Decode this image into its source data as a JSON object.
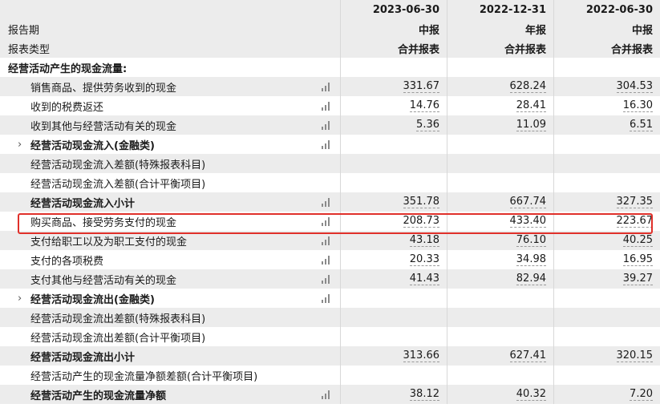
{
  "header": {
    "dates": [
      "2023-06-30",
      "2022-12-31",
      "2022-06-30"
    ],
    "report_period_label": "报告期",
    "report_periods": [
      "中报",
      "年报",
      "中报"
    ],
    "report_type_label": "报表类型",
    "report_types": [
      "合并报表",
      "合并报表",
      "合并报表"
    ]
  },
  "section_title": "经营活动产生的现金流量:",
  "rows": [
    {
      "label": "销售商品、提供劳务收到的现金",
      "values": [
        "331.67",
        "628.24",
        "304.53"
      ]
    },
    {
      "label": "收到的税费返还",
      "values": [
        "14.76",
        "28.41",
        "16.30"
      ]
    },
    {
      "label": "收到其他与经营活动有关的现金",
      "values": [
        "5.36",
        "11.09",
        "6.51"
      ]
    },
    {
      "label": "经营活动现金流入(金融类)",
      "values": [
        "",
        "",
        ""
      ]
    },
    {
      "label": "经营活动现金流入差额(特殊报表科目)",
      "values": [
        "",
        "",
        ""
      ]
    },
    {
      "label": "经营活动现金流入差额(合计平衡项目)",
      "values": [
        "",
        "",
        ""
      ]
    },
    {
      "label": "经营活动现金流入小计",
      "values": [
        "351.78",
        "667.74",
        "327.35"
      ]
    },
    {
      "label": "购买商品、接受劳务支付的现金",
      "values": [
        "208.73",
        "433.40",
        "223.67"
      ]
    },
    {
      "label": "支付给职工以及为职工支付的现金",
      "values": [
        "43.18",
        "76.10",
        "40.25"
      ]
    },
    {
      "label": "支付的各项税费",
      "values": [
        "20.33",
        "34.98",
        "16.95"
      ]
    },
    {
      "label": "支付其他与经营活动有关的现金",
      "values": [
        "41.43",
        "82.94",
        "39.27"
      ]
    },
    {
      "label": "经营活动现金流出(金融类)",
      "values": [
        "",
        "",
        ""
      ]
    },
    {
      "label": "经营活动现金流出差额(特殊报表科目)",
      "values": [
        "",
        "",
        ""
      ]
    },
    {
      "label": "经营活动现金流出差额(合计平衡项目)",
      "values": [
        "",
        "",
        ""
      ]
    },
    {
      "label": "经营活动现金流出小计",
      "values": [
        "313.66",
        "627.41",
        "320.15"
      ]
    },
    {
      "label": "经营活动产生的现金流量净额差额(合计平衡项目)",
      "values": [
        "",
        "",
        ""
      ]
    },
    {
      "label": "经营活动产生的现金流量净额",
      "values": [
        "38.12",
        "40.32",
        "7.20"
      ]
    }
  ],
  "icons": {
    "chart": "bar-chart-icon",
    "expand": "chevron-right-icon"
  },
  "colors": {
    "highlight": "#e0302a",
    "row_shade": "#ececec"
  }
}
